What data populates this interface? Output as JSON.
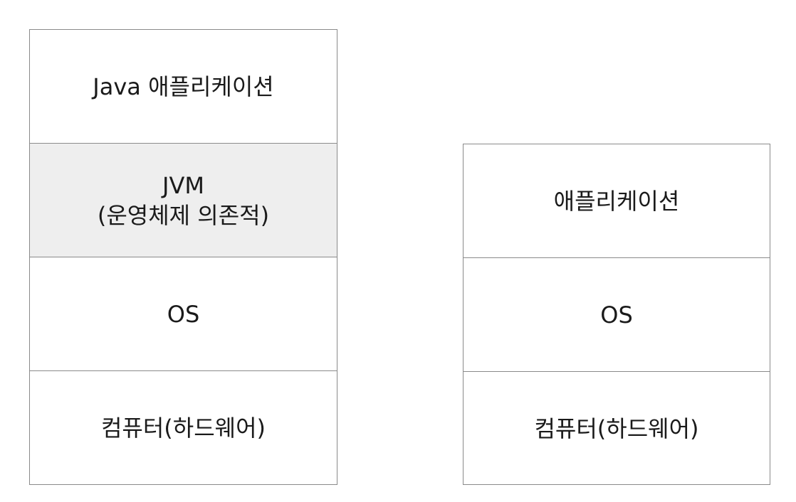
{
  "java_stack": {
    "layers": [
      {
        "label": "Java 애플리케이션"
      },
      {
        "label": "JVM",
        "sublabel": "(운영체제 의존적)"
      },
      {
        "label": "OS"
      },
      {
        "label": "컴퓨터(하드웨어)"
      }
    ]
  },
  "native_stack": {
    "layers": [
      {
        "label": "애플리케이션"
      },
      {
        "label": "OS"
      },
      {
        "label": "컴퓨터(하드웨어)"
      }
    ]
  },
  "colors": {
    "border": "#8a8a8a",
    "highlight_fill": "#eeeeee",
    "text": "#1a1a1a"
  }
}
